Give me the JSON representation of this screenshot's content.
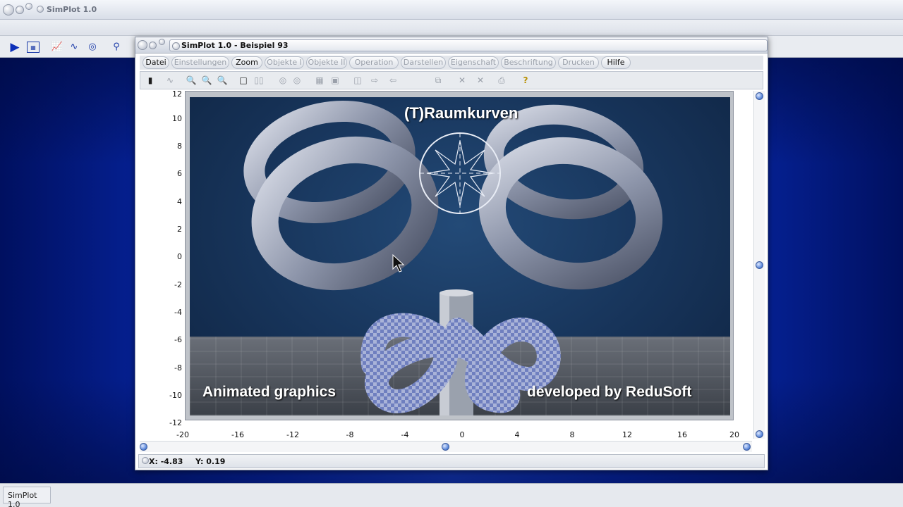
{
  "app": {
    "title": "SimPlot 1.0",
    "status_label": "SimPlot 1.0"
  },
  "inner_window": {
    "title": "SimPlot 1.0 - Beispiel 93"
  },
  "menu": [
    {
      "label": "Datei",
      "enabled": true
    },
    {
      "label": "Einstellungen",
      "enabled": false
    },
    {
      "label": "Zoom",
      "enabled": true
    },
    {
      "label": "Objekte I",
      "enabled": false
    },
    {
      "label": "Objekte II",
      "enabled": false
    },
    {
      "label": "Operation",
      "enabled": false
    },
    {
      "label": "Darstellen",
      "enabled": false
    },
    {
      "label": "Eigenschaft",
      "enabled": false
    },
    {
      "label": "Beschriftung",
      "enabled": false
    },
    {
      "label": "Drucken",
      "enabled": false
    },
    {
      "label": "Hilfe",
      "enabled": true
    }
  ],
  "axes": {
    "y_ticks": [
      "12",
      "10",
      "8",
      "6",
      "4",
      "2",
      "0",
      "-2",
      "-4",
      "-6",
      "-8",
      "-10",
      "-12"
    ],
    "x_ticks": [
      "-20",
      "-16",
      "-12",
      "-8",
      "-4",
      "0",
      "4",
      "8",
      "12",
      "16",
      "20"
    ]
  },
  "graphic": {
    "title": "(T)Raumkurven",
    "left_caption": "Animated graphics",
    "right_caption": "developed by ReduSoft"
  },
  "coords": {
    "x": "X: -4.83",
    "y": "Y: 0.19"
  },
  "colors": {
    "desktop_accent": "#1f4fe8",
    "graphic_bg": "#17345a",
    "torus": "#9aa3b8"
  }
}
